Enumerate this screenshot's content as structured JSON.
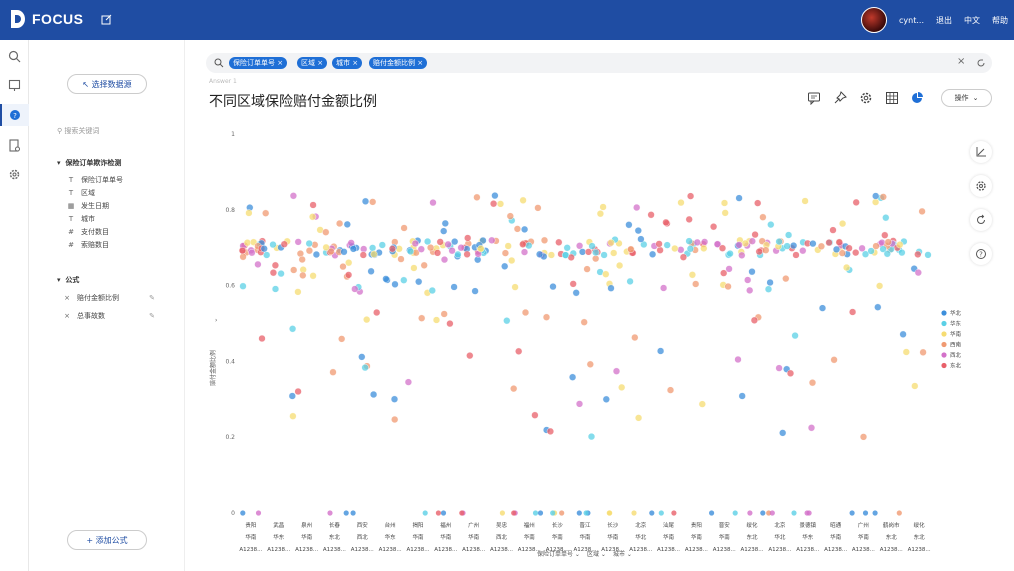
{
  "app": {
    "name": "FOCUS"
  },
  "user": {
    "name": "cynt...",
    "logout": "退出",
    "lang": "中文",
    "help": "帮助"
  },
  "panel": {
    "select_source": "选择数据源",
    "search_placeholder": "搜索关键词",
    "source_name": "保险订单欺诈检测",
    "fields": [
      {
        "icon": "text",
        "label": "保险订单单号"
      },
      {
        "icon": "text",
        "label": "区域"
      },
      {
        "icon": "date",
        "label": "发生日期"
      },
      {
        "icon": "text",
        "label": "城市"
      },
      {
        "icon": "num",
        "label": "支付数目"
      },
      {
        "icon": "num",
        "label": "索赔数目"
      }
    ],
    "formula_header": "公式",
    "formulas": [
      {
        "label": "赔付金额比例"
      },
      {
        "label": "总事故数"
      }
    ],
    "add_formula": "添加公式"
  },
  "filters": [
    "保险订单单号",
    "区域",
    "城市",
    "赔付金额比例"
  ],
  "title": "不同区域保险赔付金额比例",
  "small_label": "Answer 1",
  "actions": {
    "operate": "操作"
  },
  "colors": {
    "primary": "#1f4da3",
    "tag": "#1f6fd6"
  },
  "chart_data": {
    "type": "scatter",
    "ylabel": "赔付金额比例",
    "ylim": [
      0,
      1
    ],
    "yticks": [
      "0",
      "0.2",
      "0.4",
      "0.6",
      "0.8",
      "1"
    ],
    "legend_position": "right",
    "series": [
      {
        "name": "华北",
        "color": "#3d8fdb"
      },
      {
        "name": "华东",
        "color": "#5bd0e6"
      },
      {
        "name": "华南",
        "color": "#f6dc72"
      },
      {
        "name": "西南",
        "color": "#f09a72"
      },
      {
        "name": "西北",
        "color": "#d371c9"
      },
      {
        "name": "东北",
        "color": "#e8606a"
      }
    ],
    "x_groups": [
      {
        "city": "贵阳",
        "region": "华南",
        "id": "A1238..."
      },
      {
        "city": "武昌",
        "region": "华东",
        "id": "A1238..."
      },
      {
        "city": "泉州",
        "region": "华南",
        "id": "A1238..."
      },
      {
        "city": "长春",
        "region": "东北",
        "id": "A1238..."
      },
      {
        "city": "西安",
        "region": "西北",
        "id": "A1238..."
      },
      {
        "city": "台州",
        "region": "华东",
        "id": "A1238..."
      },
      {
        "city": "揭阳",
        "region": "华南",
        "id": "A1238..."
      },
      {
        "city": "福州",
        "region": "华南",
        "id": "A1238..."
      },
      {
        "city": "广州",
        "region": "华南",
        "id": "A1238..."
      },
      {
        "city": "吴忠",
        "region": "西北",
        "id": "A1238..."
      },
      {
        "city": "福州",
        "region": "华南",
        "id": "A1238..."
      },
      {
        "city": "长沙",
        "region": "华南",
        "id": "A1238..."
      },
      {
        "city": "晋江",
        "region": "华南",
        "id": "A1238..."
      },
      {
        "city": "长沙",
        "region": "华南",
        "id": "A1238..."
      },
      {
        "city": "北京",
        "region": "华北",
        "id": "A1238..."
      },
      {
        "city": "汕尾",
        "region": "华南",
        "id": "A1238..."
      },
      {
        "city": "贵阳",
        "region": "华南",
        "id": "A1238..."
      },
      {
        "city": "晋安",
        "region": "华南",
        "id": "A1238..."
      },
      {
        "city": "绥化",
        "region": "东北",
        "id": "A1238..."
      },
      {
        "city": "北京",
        "region": "华北",
        "id": "A1238..."
      },
      {
        "city": "景德镇",
        "region": "华东",
        "id": "A1238..."
      },
      {
        "city": "昭通",
        "region": "华南",
        "id": "A1238..."
      },
      {
        "city": "广州",
        "region": "华南",
        "id": "A1238..."
      },
      {
        "city": "鹤岗市",
        "region": "东北",
        "id": "A1238..."
      },
      {
        "city": "绥化",
        "region": "东北",
        "id": "A1238..."
      }
    ],
    "x_axis_fields": [
      "保险订单单号",
      "区域",
      "城市"
    ]
  }
}
